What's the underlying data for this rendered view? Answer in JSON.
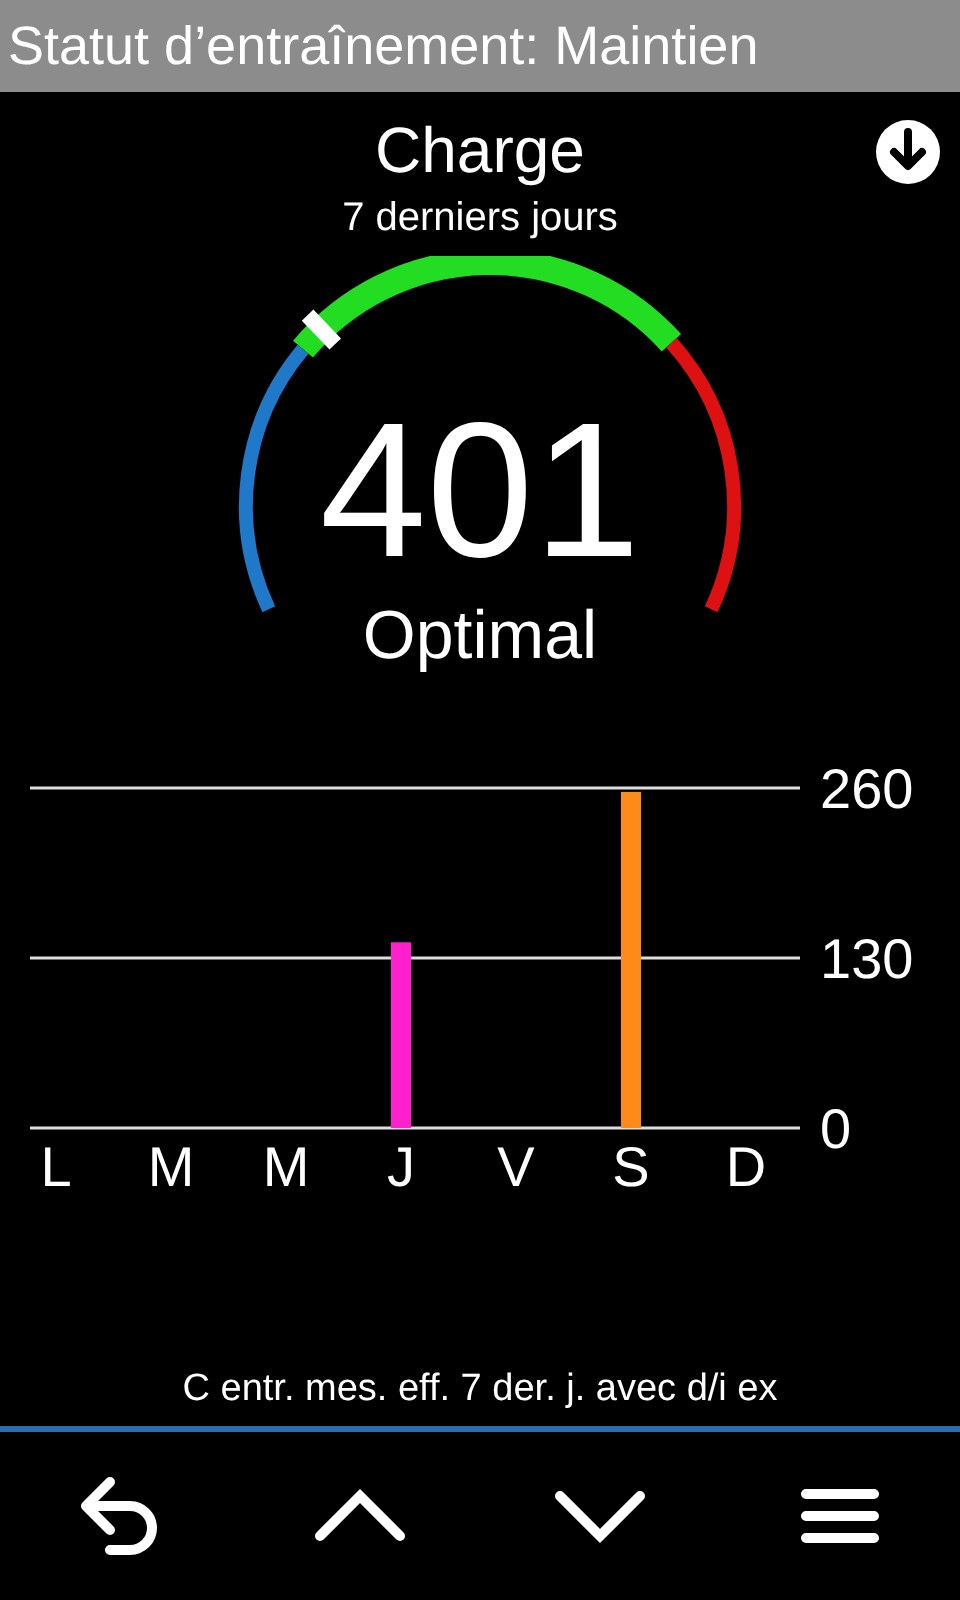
{
  "header": {
    "title": "Statut d’entraînement: Maintien"
  },
  "metric": {
    "title": "Charge",
    "subtitle": "7 derniers jours"
  },
  "gauge": {
    "value": "401",
    "status": "Optimal"
  },
  "chart_data": {
    "type": "bar",
    "categories": [
      "L",
      "M",
      "M",
      "J",
      "V",
      "S",
      "D"
    ],
    "series": [
      {
        "color": "#ff22cc",
        "values": [
          null,
          null,
          null,
          142,
          null,
          null,
          null
        ]
      },
      {
        "color": "#ff8a1a",
        "values": [
          null,
          null,
          null,
          null,
          null,
          257,
          null
        ]
      }
    ],
    "ylim": [
      0,
      260
    ],
    "yticks": [
      0,
      130,
      260
    ]
  },
  "caption": "C entr. mes. eff. 7 der. j. avec d/i ex"
}
